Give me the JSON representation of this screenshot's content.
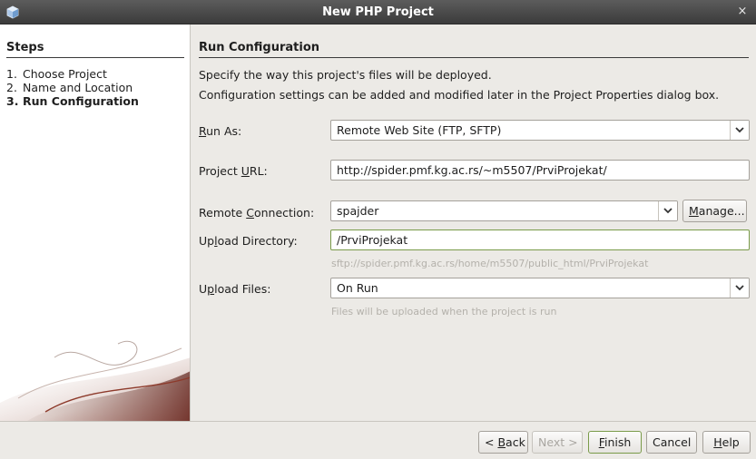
{
  "window": {
    "title": "New PHP Project",
    "close_glyph": "×",
    "icon": "app-cube-icon"
  },
  "steps": {
    "heading": "Steps",
    "items": [
      {
        "num": "1.",
        "label": "Choose Project"
      },
      {
        "num": "2.",
        "label": "Name and Location"
      },
      {
        "num": "3.",
        "label": "Run Configuration"
      }
    ],
    "current_index": 2
  },
  "main": {
    "heading": "Run Configuration",
    "description_1": "Specify the way this project's files will be deployed.",
    "description_2": "Configuration settings can be added and modified later in the Project Properties dialog box.",
    "run_as": {
      "label_pre": "",
      "label_mn": "R",
      "label_post": "un As:",
      "value": "Remote Web Site (FTP, SFTP)"
    },
    "project_url": {
      "label_pre": "Project ",
      "label_mn": "U",
      "label_post": "RL:",
      "value": "http://spider.pmf.kg.ac.rs/~m5507/PrviProjekat/"
    },
    "remote_connection": {
      "label_pre": "Remote ",
      "label_mn": "C",
      "label_post": "onnection:",
      "value": "spajder",
      "manage_pre": "",
      "manage_mn": "M",
      "manage_post": "anage..."
    },
    "upload_directory": {
      "label_pre": "Up",
      "label_mn": "l",
      "label_post": "oad Directory:",
      "value": "/PrviProjekat",
      "hint": "sftp://spider.pmf.kg.ac.rs/home/m5507/public_html/PrviProjekat"
    },
    "upload_files": {
      "label_pre": "U",
      "label_mn": "p",
      "label_post": "load Files:",
      "value": "On Run",
      "hint": "Files will be uploaded when the project is run"
    }
  },
  "buttons": {
    "back": {
      "pre": "< ",
      "mn": "B",
      "post": "ack"
    },
    "next": {
      "label": "Next >"
    },
    "finish": {
      "pre": "",
      "mn": "F",
      "post": "inish"
    },
    "cancel": {
      "label": "Cancel"
    },
    "help": {
      "pre": "",
      "mn": "H",
      "post": "elp"
    }
  },
  "colors": {
    "titlebar": "#3b3b3b",
    "focus_border": "#7a9b4a",
    "hint_text": "#b4b1ab"
  }
}
